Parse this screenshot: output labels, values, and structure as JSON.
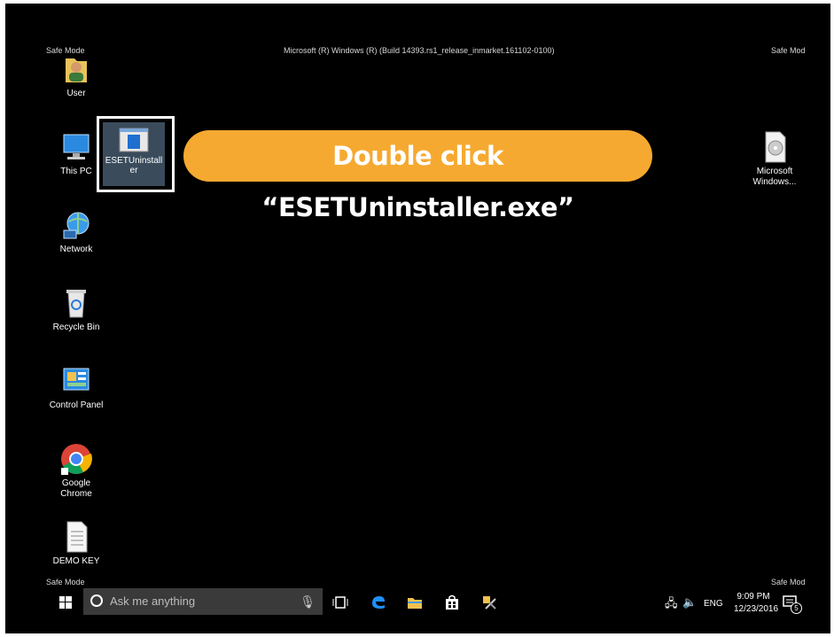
{
  "watermarks": {
    "top_left": "Safe Mode",
    "top_center": "Microsoft (R) Windows (R) (Build 14393.rs1_release_inmarket.161102-0100)",
    "top_right": "Safe Mod",
    "bottom_left": "Safe Mode",
    "bottom_right": "Safe Mod"
  },
  "desktop_icons": {
    "user": "User",
    "this_pc": "This PC",
    "eset": "ESETUninstaller",
    "network": "Network",
    "recycle_bin": "Recycle Bin",
    "control_panel": "Control Panel",
    "chrome": "Google Chrome",
    "demo_key": "DEMO KEY",
    "microsoft_windows_line1": "Microsoft",
    "microsoft_windows_line2": "Windows..."
  },
  "callout": {
    "text": "Double click “ESETUninstaller.exe”"
  },
  "taskbar": {
    "search_placeholder": "Ask me anything",
    "language": "ENG",
    "time": "9:09 PM",
    "date": "12/23/2016",
    "notification_count": "5"
  }
}
